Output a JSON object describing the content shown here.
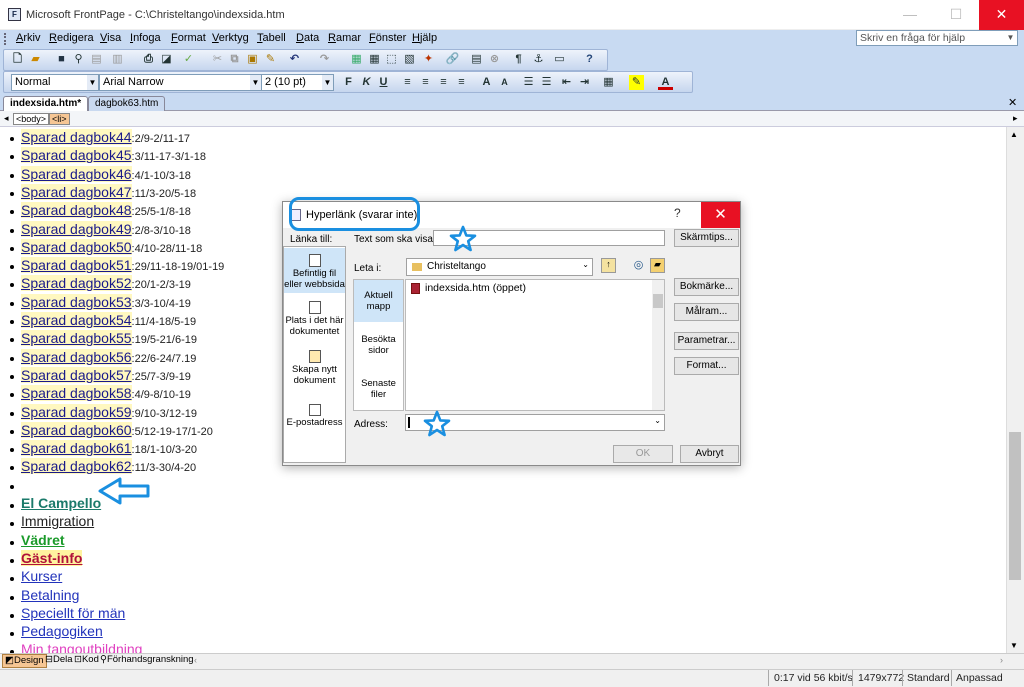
{
  "window": {
    "title": "Microsoft FrontPage - C:\\Christeltango\\indexsida.htm",
    "icon": "frontpage-app-icon"
  },
  "menu": {
    "items": [
      "Arkiv",
      "Redigera",
      "Visa",
      "Infoga",
      "Format",
      "Verktyg",
      "Tabell",
      "Data",
      "Ramar",
      "Fönster",
      "Hjälp"
    ],
    "help_placeholder": "Skriv en fråga för hjälp"
  },
  "format_bar": {
    "style": "Normal",
    "font": "Arial Narrow",
    "size": "2  (10 pt)"
  },
  "tabs": [
    "indexsida.htm*",
    "dagbok63.htm"
  ],
  "tag_selector": [
    "<body>",
    "<li>"
  ],
  "page_items": [
    {
      "link": "Sparad dagbok44",
      "date": ":2/9-2/11-17"
    },
    {
      "link": "Sparad dagbok45",
      "date": ":3/11-17-3/1-18"
    },
    {
      "link": "Sparad dagbok46",
      "date": ":4/1-10/3-18"
    },
    {
      "link": "Sparad dagbok47",
      "date": ":11/3-20/5-18"
    },
    {
      "link": "Sparad dagbok48",
      "date": ":25/5-1/8-18"
    },
    {
      "link": "Sparad dagbok49",
      "date": ":2/8-3/10-18"
    },
    {
      "link": "Sparad dagbok50",
      "date": ":4/10-28/11-18"
    },
    {
      "link": "Sparad dagbok51",
      "date": ":29/11-18-19/01-19"
    },
    {
      "link": "Sparad dagbok52",
      "date": ":20/1-2/3-19"
    },
    {
      "link": "Sparad dagbok53",
      "date": ":3/3-10/4-19"
    },
    {
      "link": "Sparad dagbok54",
      "date": ":11/4-18/5-19"
    },
    {
      "link": "Sparad dagbok55",
      "date": ":19/5-21/6-19"
    },
    {
      "link": "Sparad dagbok56",
      "date": ":22/6-24/7.19"
    },
    {
      "link": "Sparad dagbok57",
      "date": ":25/7-3/9-19"
    },
    {
      "link": "Sparad dagbok58",
      "date": ":4/9-8/10-19"
    },
    {
      "link": "Sparad dagbok59",
      "date": ":9/10-3/12-19"
    },
    {
      "link": "Sparad dagbok60",
      "date": ":5/12-19-17/1-20"
    },
    {
      "link": "Sparad dagbok61",
      "date": ":18/1-10/3-20"
    },
    {
      "link": "Sparad dagbok62",
      "date": ":11/3-30/4-20"
    }
  ],
  "page_links": [
    {
      "text": "El Campello",
      "color": "#1a7a6a",
      "bold": true,
      "bg": "#ffffff"
    },
    {
      "text": "Immigration",
      "color": "#222222",
      "bold": false,
      "bg": "#ffffff"
    },
    {
      "text": "Vädret",
      "color": "#1a9a2a",
      "bold": true,
      "bg": "#ffffff"
    },
    {
      "text": "Gäst-info",
      "color": "#b0103a",
      "bold": true,
      "bg": "#fff3a0"
    },
    {
      "text": "Kurser",
      "color": "#2233bb",
      "bold": false,
      "bg": "#ffffff"
    },
    {
      "text": "Betalning",
      "color": "#2233bb",
      "bold": false,
      "bg": "#ffffff"
    },
    {
      "text": "Speciellt för män",
      "color": "#2233bb",
      "bold": false,
      "bg": "#ffffff"
    },
    {
      "text": "Pedagogiken",
      "color": "#2233bb",
      "bold": false,
      "bg": "#ffffff"
    },
    {
      "text": "Min tangoutbildning",
      "color": "#e040c0",
      "bold": false,
      "bg": "#ffffff"
    }
  ],
  "view_tabs": [
    "Design",
    "Dela",
    "Kod",
    "Förhandsgranskning"
  ],
  "status": {
    "speed": "0:17 vid 56 kbit/s",
    "size": "1479x772",
    "mode": "Standard",
    "fit": "Anpassad"
  },
  "dialog": {
    "title": "Hyperlänk (svarar inte)",
    "help": "?",
    "link_to_label": "Länka till:",
    "text_label": "Text som ska visas:",
    "text_value": "",
    "screentip_button": "Skärmtips...",
    "look_in_label": "Leta i:",
    "look_in_value": "Christeltango",
    "link_to_options": [
      "Befintlig fil eller webbsida",
      "Plats i det här dokumentet",
      "Skapa nytt dokument",
      "E-postadress"
    ],
    "places": [
      "Aktuell mapp",
      "Besökta sidor",
      "Senaste filer"
    ],
    "files": [
      "indexsida.htm (öppet)"
    ],
    "address_label": "Adress:",
    "address_value": "",
    "side_buttons": [
      "Bokmärke...",
      "Målram...",
      "Parametrar...",
      "Format..."
    ],
    "ok_label": "OK",
    "cancel_label": "Avbryt"
  }
}
